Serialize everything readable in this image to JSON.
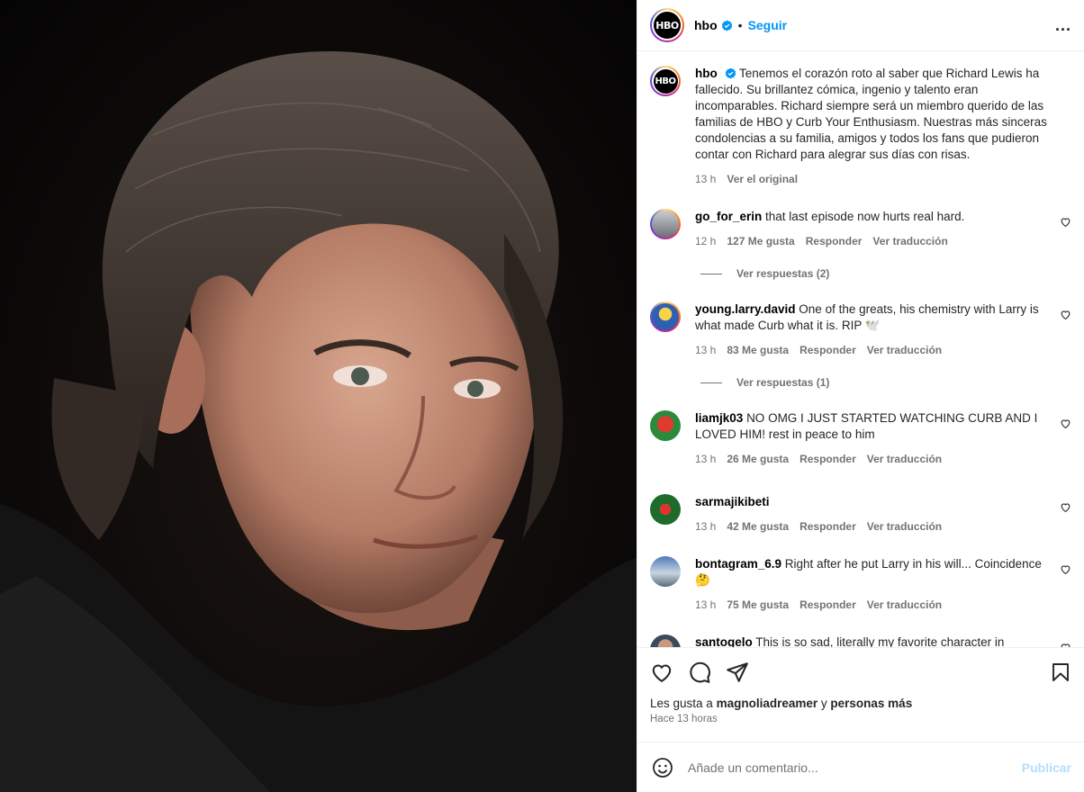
{
  "header": {
    "username": "hbo",
    "logo_text": "HBO",
    "separator": "•",
    "follow_label": "Seguir",
    "more_label": "..."
  },
  "caption": {
    "username": "hbo",
    "text": "Tenemos el corazón roto al saber que Richard Lewis ha fallecido. Su brillantez cómica, ingenio y talento eran incomparables. Richard siempre será un miembro querido de las familias de HBO y Curb Your Enthusiasm. Nuestras más sinceras condolencias a su familia, amigos y todos los fans que pudieron contar con Richard para alegrar sus días con risas.",
    "time": "13 h",
    "see_original": "Ver el original"
  },
  "comments": [
    {
      "username": "go_for_erin",
      "text": "that last episode now hurts real hard.",
      "time": "12 h",
      "likes": "127 Me gusta",
      "reply": "Responder",
      "translate": "Ver traducción",
      "replies": "Ver respuestas (2)"
    },
    {
      "username": "young.larry.david",
      "text": "One of the greats, his chemistry with Larry is what made Curb what it is. RIP 🕊️",
      "time": "13 h",
      "likes": "83 Me gusta",
      "reply": "Responder",
      "translate": "Ver traducción",
      "replies": "Ver respuestas (1)"
    },
    {
      "username": "liamjk03",
      "text": "NO OMG I JUST STARTED WATCHING CURB AND I LOVED HIM! rest in peace to him",
      "time": "13 h",
      "likes": "26 Me gusta",
      "reply": "Responder",
      "translate": "Ver traducción"
    },
    {
      "username": "sarmajikibeti",
      "text": "",
      "time": "13 h",
      "likes": "42 Me gusta",
      "reply": "Responder",
      "translate": "Ver traducción"
    },
    {
      "username": "bontagram_6.9",
      "text": "Right after he put Larry in his will... Coincidence 🤔",
      "time": "13 h",
      "likes": "75 Me gusta",
      "reply": "Responder",
      "translate": "Ver traducción"
    },
    {
      "username": "santogelo",
      "text": "This is so sad, literally my favorite character in Enthusiasm"
    }
  ],
  "likes": {
    "prefix": "Les gusta a",
    "user": "magnoliadreamer",
    "joiner": "y",
    "others": "personas más"
  },
  "posted_ago": "Hace 13 horas",
  "composer": {
    "placeholder": "Añade un comentario...",
    "publish_label": "Publicar"
  },
  "icons": [
    "heart-icon",
    "comment-icon",
    "share-icon",
    "bookmark-icon",
    "emoji-icon",
    "verified-icon",
    "more-icon"
  ],
  "colors": {
    "link": "#0095f6",
    "muted": "#737373",
    "publish_disabled": "#b2dffc",
    "verified": "#0095f6"
  }
}
